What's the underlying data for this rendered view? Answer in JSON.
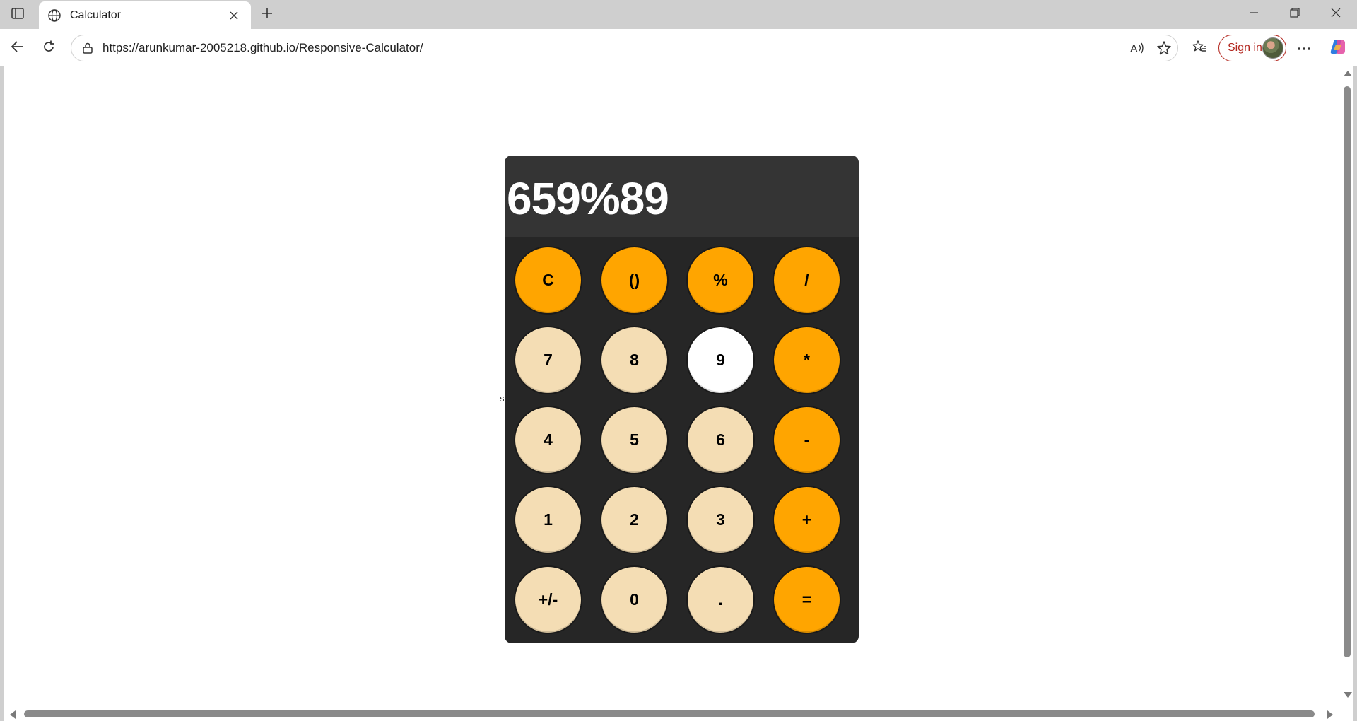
{
  "browser": {
    "tab_title": "Calculator",
    "url": "https://arunkumar-2005218.github.io/Responsive-Calculator/",
    "signin_label": "Sign in"
  },
  "page": {
    "stray_text": "s"
  },
  "calculator": {
    "display": "659%89",
    "keys": [
      {
        "label": "C",
        "kind": "op"
      },
      {
        "label": "()",
        "kind": "op"
      },
      {
        "label": "%",
        "kind": "op"
      },
      {
        "label": "/",
        "kind": "op"
      },
      {
        "label": "7",
        "kind": "num"
      },
      {
        "label": "8",
        "kind": "num"
      },
      {
        "label": "9",
        "kind": "active"
      },
      {
        "label": "*",
        "kind": "op"
      },
      {
        "label": "4",
        "kind": "num"
      },
      {
        "label": "5",
        "kind": "num"
      },
      {
        "label": "6",
        "kind": "num"
      },
      {
        "label": "-",
        "kind": "op"
      },
      {
        "label": "1",
        "kind": "num"
      },
      {
        "label": "2",
        "kind": "num"
      },
      {
        "label": "3",
        "kind": "num"
      },
      {
        "label": "+",
        "kind": "op"
      },
      {
        "label": "+/-",
        "kind": "num"
      },
      {
        "label": "0",
        "kind": "num"
      },
      {
        "label": ".",
        "kind": "num"
      },
      {
        "label": "=",
        "kind": "op"
      }
    ],
    "colors": {
      "operator": "#ffa500",
      "number": "#f4ddb4",
      "pressed": "#ffffff",
      "body": "#262626",
      "display_bg": "#343434"
    }
  }
}
